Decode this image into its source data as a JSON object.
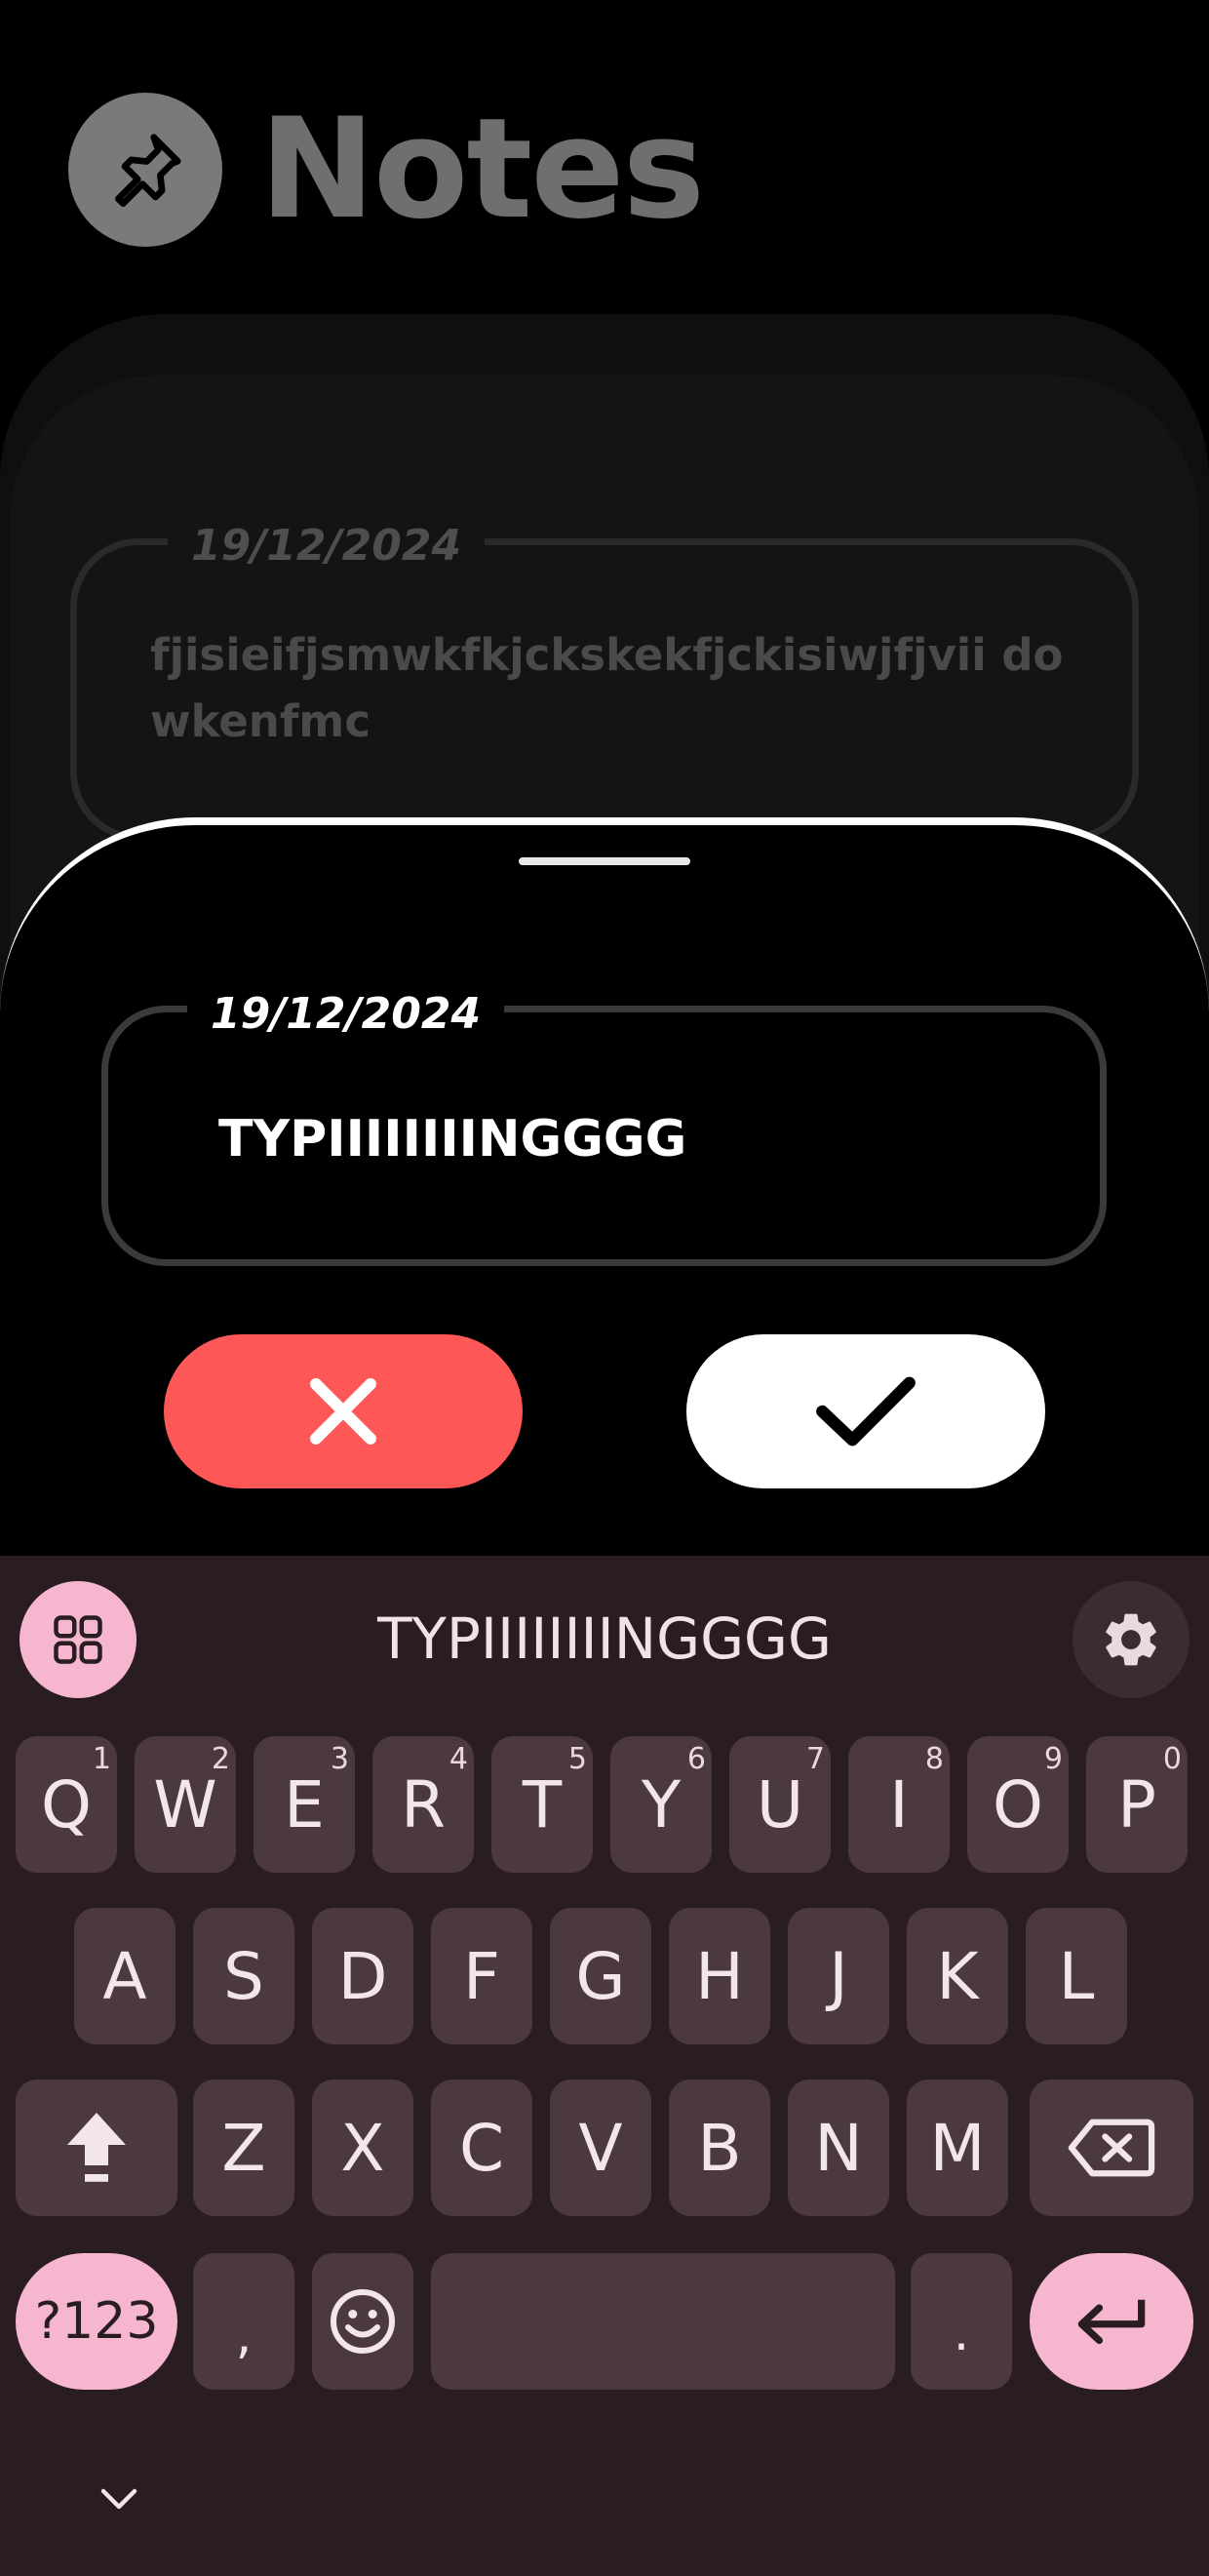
{
  "app": {
    "title": "Notes",
    "pin_icon": "pushpin-icon"
  },
  "background_note": {
    "date": "19/12/2024",
    "text": "fjisieifjsmwkfkjckskekfjckisiwjfjvii dowkenfmc"
  },
  "editor": {
    "date": "19/12/2024",
    "value": "TYPIIIIIIIINGGGG",
    "cancel_icon": "close-icon",
    "confirm_icon": "check-icon"
  },
  "keyboard": {
    "suggestion": "TYPIIIIIIIINGGGG",
    "row1": [
      "Q",
      "W",
      "E",
      "R",
      "T",
      "Y",
      "U",
      "I",
      "O",
      "P"
    ],
    "row1_hints": [
      "1",
      "2",
      "3",
      "4",
      "5",
      "6",
      "7",
      "8",
      "9",
      "0"
    ],
    "row2": [
      "A",
      "S",
      "D",
      "F",
      "G",
      "H",
      "J",
      "K",
      "L"
    ],
    "row3": [
      "Z",
      "X",
      "C",
      "V",
      "B",
      "N",
      "M"
    ],
    "symbols_label": "?123",
    "comma": ",",
    "period": ".",
    "colors": {
      "background": "#2a1d22",
      "key": "#4b393f",
      "accent": "#f7b6cf"
    }
  },
  "colors": {
    "cancel": "#fe5757",
    "confirm": "#ffffff"
  }
}
